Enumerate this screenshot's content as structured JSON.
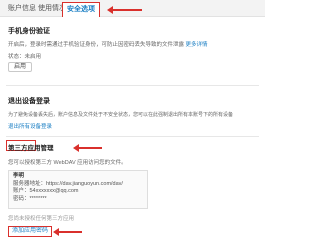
{
  "tabs": [
    {
      "label": "账户信息"
    },
    {
      "label": "使用情况"
    },
    {
      "label": "安全选项",
      "active": true
    }
  ],
  "phone_verify": {
    "title": "手机身份验证",
    "desc": "开启后，登录时需通过手机验证身份，可防止因密码丢失导致的文件泄露",
    "link": "更多详情",
    "status": "状态：未启用",
    "button": "启用"
  },
  "logout_all": {
    "title": "退出设备登录",
    "desc": "为了避免设备丢失后，账户信息及文件处于不安全状态，您可以在此强制退出所有本账号下的所有设备",
    "link": "退出所有设备登录"
  },
  "third_party": {
    "title": "第三方应用管理",
    "desc": "您可以授权第三方 WebDAV 应用访问您的文件。",
    "item_name": "李明",
    "server": "服务器地址：https://dav.jianguoyun.com/dav/",
    "user": "账户：54xxxxxxx@qq.com",
    "password": "密码：********",
    "note": "您尚未授权任何第三方应用",
    "add_button": "添加应用密码"
  },
  "colors": {
    "accent": "#1b7fc4",
    "annotation": "#d9302c"
  }
}
